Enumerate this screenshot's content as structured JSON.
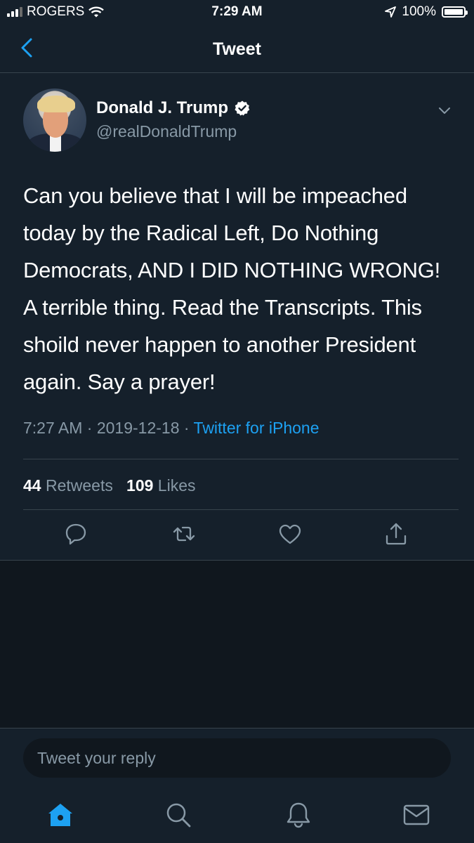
{
  "status_bar": {
    "carrier": "ROGERS",
    "time": "7:29 AM",
    "battery": "100%",
    "battery_level": 1.0,
    "icons": [
      "signal-icon",
      "wifi-icon",
      "location-arrow-icon",
      "battery-icon"
    ]
  },
  "nav": {
    "title": "Tweet",
    "back_icon": "chevron-left-icon"
  },
  "tweet": {
    "author_name": "Donald J. Trump",
    "handle": "@realDonaldTrump",
    "verified": true,
    "text": "Can you believe that I will be impeached today by the Radical Left, Do Nothing Democrats, AND I DID NOTHING WRONG! A terrible thing. Read the Transcripts. This shoild never happen to another President again. Say a prayer!",
    "time": "7:27 AM",
    "date": "2019-12-18",
    "separator": "·",
    "source": "Twitter for iPhone",
    "retweets_count": "44",
    "retweets_label": "Retweets",
    "likes_count": "109",
    "likes_label": "Likes"
  },
  "actions": [
    "reply-icon",
    "retweet-icon",
    "like-icon",
    "share-icon"
  ],
  "reply": {
    "placeholder": "Tweet your reply"
  },
  "tab_bar": [
    "home-icon",
    "search-icon",
    "notifications-icon",
    "messages-icon"
  ],
  "colors": {
    "background": "#15202b",
    "background_dark": "#10171e",
    "accent": "#1da1f2",
    "secondary_text": "#8899a6",
    "border": "#38444d"
  }
}
